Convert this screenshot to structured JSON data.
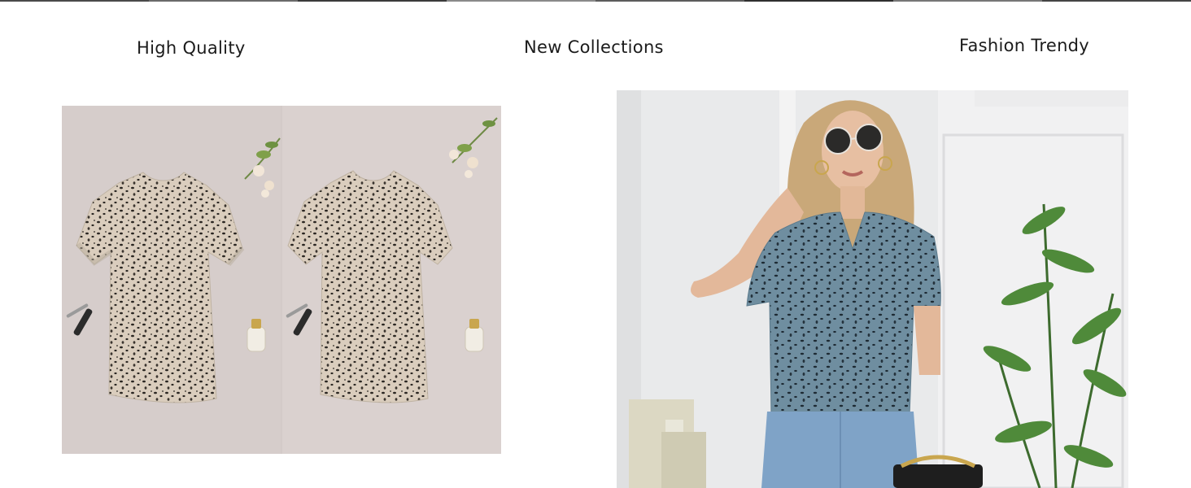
{
  "headings": {
    "left": "High Quality",
    "center": "New Collections",
    "right": "Fashion Trendy"
  },
  "images": {
    "flatlay": {
      "icon": "leopard-print-blouse-flatlay-image"
    },
    "model": {
      "icon": "woman-in-blue-print-blouse-image"
    }
  },
  "colors": {
    "background": "#ffffff",
    "heading_text": "#1b1b1b",
    "flatlay_backdrop": "#d8cfcd",
    "blouse_beige": "#d9cdbd",
    "blouse_blue": "#6f8ea0"
  }
}
